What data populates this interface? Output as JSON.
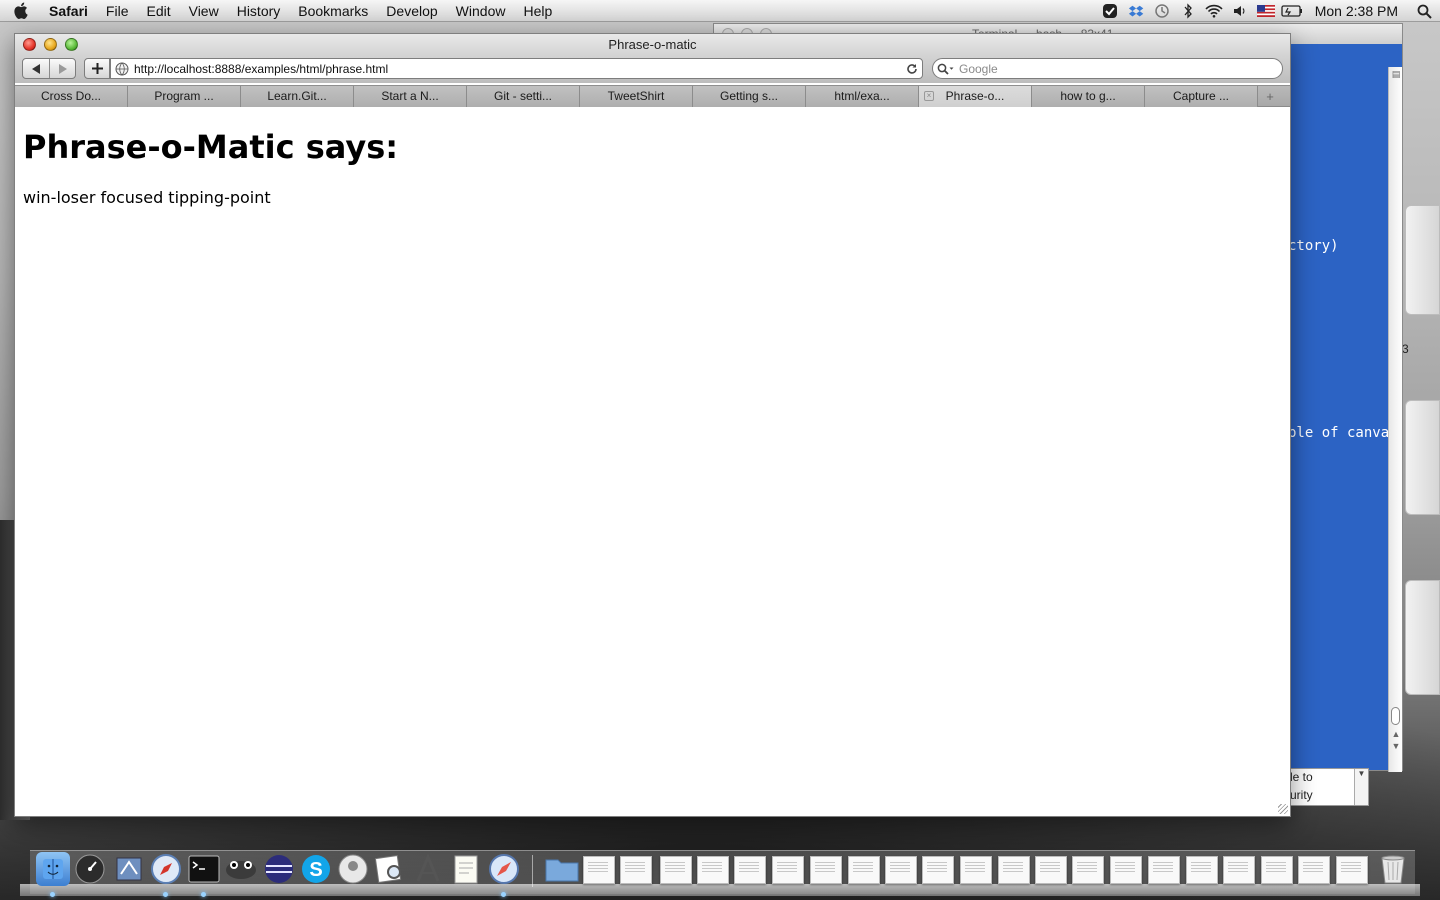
{
  "menubar": {
    "app_name": "Safari",
    "menus": [
      "File",
      "Edit",
      "View",
      "History",
      "Bookmarks",
      "Develop",
      "Window",
      "Help"
    ],
    "clock": "Mon 2:38 PM"
  },
  "terminal": {
    "title": "Terminal — bash — 83x41",
    "text_line_1": "ctory)",
    "text_line_2": "ple of canva",
    "drive_label": "3"
  },
  "fragment": {
    "line_1": "le to",
    "line_2": "urity"
  },
  "safari": {
    "window_title": "Phrase-o-matic",
    "url": "http://localhost:8888/examples/html/phrase.html",
    "search_placeholder": "Google",
    "tabs": [
      {
        "label": "Cross Do..."
      },
      {
        "label": "Program ..."
      },
      {
        "label": "Learn.Git..."
      },
      {
        "label": "Start a N..."
      },
      {
        "label": "Git - setti..."
      },
      {
        "label": "TweetShirt"
      },
      {
        "label": "Getting s..."
      },
      {
        "label": "html/exa..."
      },
      {
        "label": "Phrase-o..."
      },
      {
        "label": "how to g..."
      },
      {
        "label": "Capture ..."
      }
    ],
    "active_tab_index": 8
  },
  "page": {
    "heading": "Phrase-o-Matic says:",
    "phrase": "win-loser focused tipping-point"
  },
  "colors": {
    "terminal_bg": "#2c63c4",
    "page_text": "#000000"
  },
  "dock": {
    "apps": [
      "finder-icon",
      "dashboard-icon",
      "mail-icon",
      "safari-icon",
      "terminal-icon",
      "frog-app-icon",
      "eclipse-icon",
      "skype-icon",
      "grayscale-app-icon",
      "preview-icon",
      "xcode-icon",
      "textedit-icon",
      "safari-compass-icon"
    ],
    "documents_count": 21
  }
}
